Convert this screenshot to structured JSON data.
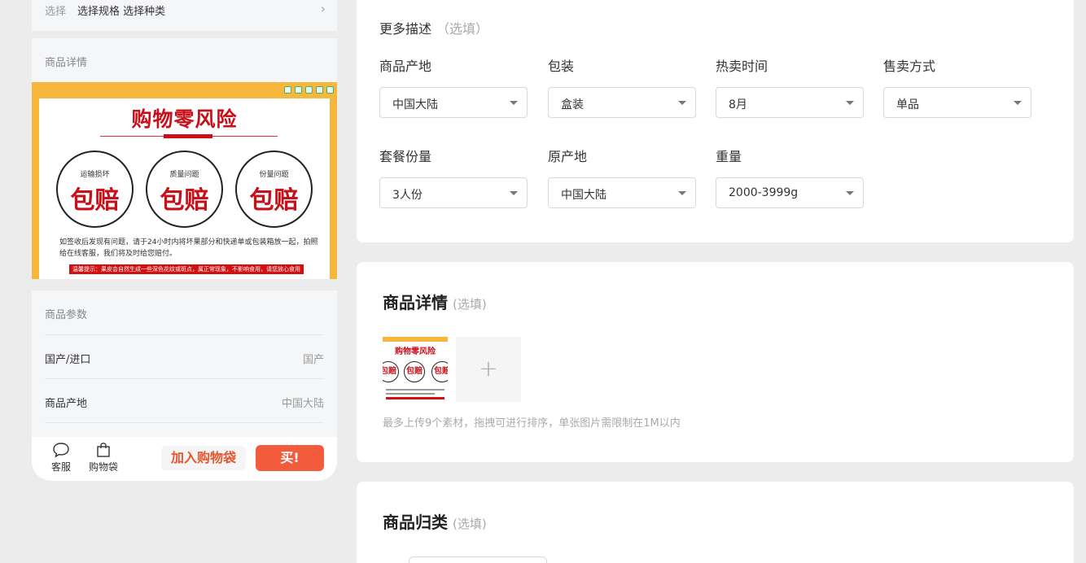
{
  "preview": {
    "spec_label": "选择",
    "spec_value": "选择规格 选择种类",
    "detail_title": "商品详情",
    "banner": {
      "title": "购物零风险",
      "circles": [
        {
          "caption": "运输损坏",
          "text": "包赔"
        },
        {
          "caption": "质量问题",
          "text": "包赔"
        },
        {
          "caption": "份量问题",
          "text": "包赔"
        }
      ],
      "note": "如签收后发现有问题，请于24小时内将坏果部分和快递单或包装箱放一起，拍照给在线客服，我们将及时给您赔付。",
      "tip": "温馨提示：果皮会自然生成一些深色花纹或斑点，属正常现象，不影响食用，请您放心食用"
    },
    "params_title": "商品参数",
    "params": [
      {
        "key": "国产/进口",
        "value": "国产"
      },
      {
        "key": "商品产地",
        "value": "中国大陆"
      }
    ],
    "bottom": {
      "service_label": "客服",
      "bag_label": "购物袋",
      "add_cart_label": "加入购物袋",
      "buy_label": "买!"
    }
  },
  "more_desc": {
    "title": "更多描述",
    "optional": "（选填）",
    "fields": [
      {
        "label": "商品产地",
        "value": "中国大陆"
      },
      {
        "label": "包装",
        "value": "盒装"
      },
      {
        "label": "热卖时间",
        "value": "8月"
      },
      {
        "label": "售卖方式",
        "value": "单品"
      },
      {
        "label": "套餐份量",
        "value": "3人份"
      },
      {
        "label": "原产地",
        "value": "中国大陆"
      },
      {
        "label": "重量",
        "value": "2000-3999g"
      }
    ]
  },
  "detail_section": {
    "title": "商品详情",
    "optional": "(选填)",
    "thumb": {
      "title": "购物零风险",
      "circle_text": "包赔"
    },
    "add_symbol": "+",
    "hint": "最多上传9个素材，拖拽可进行排序，单张图片需限制在1M以内"
  },
  "category_section": {
    "title": "商品归类",
    "optional": "(选填)"
  },
  "colors": {
    "accent": "#f25b3c",
    "banner_yellow": "#f6b73c",
    "brand_red": "#c8101a"
  }
}
